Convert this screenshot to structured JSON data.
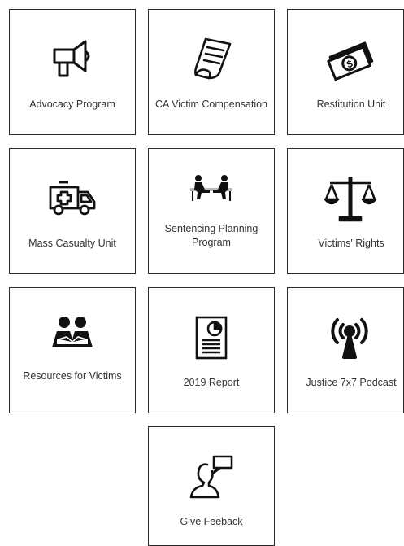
{
  "tiles": [
    {
      "label": "Advocacy Program",
      "icon": "megaphone-icon"
    },
    {
      "label": "CA Victim Compensation",
      "icon": "scroll-document-icon"
    },
    {
      "label": "Restitution Unit",
      "icon": "money-bills-icon"
    },
    {
      "label": "Mass Casualty Unit",
      "icon": "ambulance-icon"
    },
    {
      "label": "Sentencing Planning Program",
      "icon": "meeting-icon"
    },
    {
      "label": "Victims' Rights",
      "icon": "scales-of-justice-icon"
    },
    {
      "label": "Resources for Victims",
      "icon": "reading-people-icon"
    },
    {
      "label": "2019 Report",
      "icon": "report-document-icon"
    },
    {
      "label": "Justice 7x7 Podcast",
      "icon": "podcast-antenna-icon"
    },
    {
      "label": "Give Feeback",
      "icon": "person-speech-bubble-icon"
    }
  ]
}
